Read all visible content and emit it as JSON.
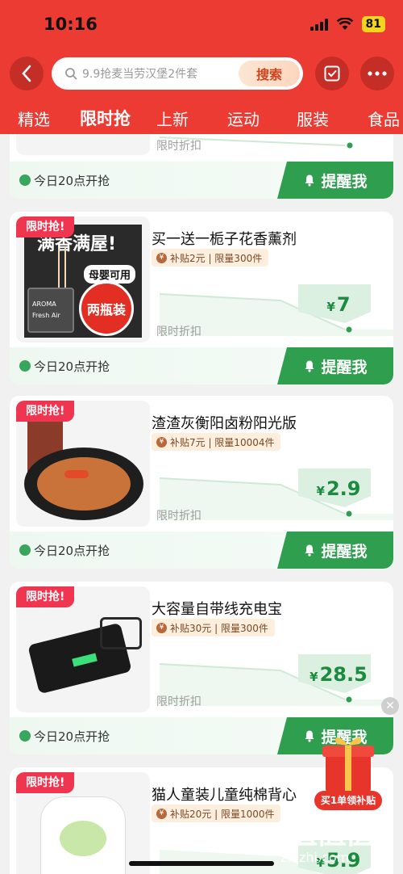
{
  "status": {
    "time": "10:16",
    "battery": "81"
  },
  "search": {
    "placeholder": "9.9抢麦当劳汉堡2件套",
    "button": "搜索"
  },
  "tabs": [
    "精选",
    "限时抢",
    "上新",
    "运动",
    "服装",
    "食品"
  ],
  "active_tab": "限时抢",
  "common": {
    "flash_tag": "限时抢!",
    "start_time": "今日20点开抢",
    "remind": "提醒我",
    "discount_label": "限时折扣",
    "yen": "¥"
  },
  "partial_card": {
    "discount_label": "限时折扣"
  },
  "items": [
    {
      "title": "买一送一栀子花香薰剂",
      "subsidy": "补贴2元 | 限量300件",
      "price": "7",
      "image_text": {
        "headline": "满香满屋!",
        "badge1": "母婴可用",
        "badge2": "两瓶装",
        "brand": "AROMA",
        "label": "Fresh Air"
      }
    },
    {
      "title": "渣渣灰衡阳卤粉阳光版",
      "subsidy": "补贴7元 | 限量10004件",
      "price": "2.9"
    },
    {
      "title": "大容量自带线充电宝",
      "subsidy": "补贴30元 | 限量300件",
      "price": "28.5"
    },
    {
      "title": "猫人童装儿童纯棉背心",
      "subsidy": "补贴20元 | 限量1000件",
      "price": "5.9"
    }
  ],
  "promo": {
    "label": "买1单领补贴"
  },
  "watermark": {
    "logo": "值值值",
    "url": "zhizhi.com"
  },
  "colors": {
    "header": "#ec3b32",
    "green": "#2f9e4e",
    "flash": "#ef3550"
  }
}
